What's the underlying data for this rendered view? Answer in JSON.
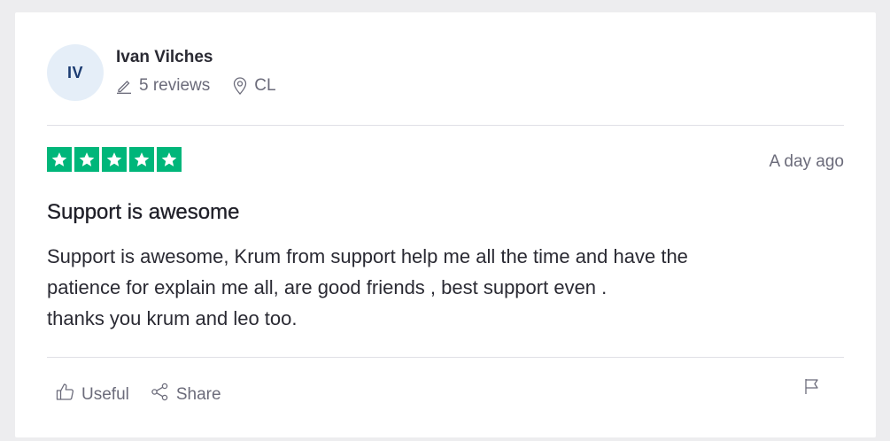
{
  "reviewer": {
    "initials": "IV",
    "name": "Ivan Vilches",
    "reviews_count": "5 reviews",
    "country": "CL"
  },
  "review": {
    "rating": 5,
    "rating_max": 5,
    "star_color": "#00b67a",
    "date": "A day ago",
    "title": "Support is awesome",
    "body_lines": [
      "Support is awesome, Krum from support help me all the time and have the",
      "patience for explain me all, are good friends , best support even .",
      "thanks you krum and leo too."
    ]
  },
  "actions": {
    "useful_label": "Useful",
    "share_label": "Share",
    "useful_icon": "thumbs-up-icon",
    "share_icon": "share-icon",
    "flag_icon": "flag-icon"
  }
}
